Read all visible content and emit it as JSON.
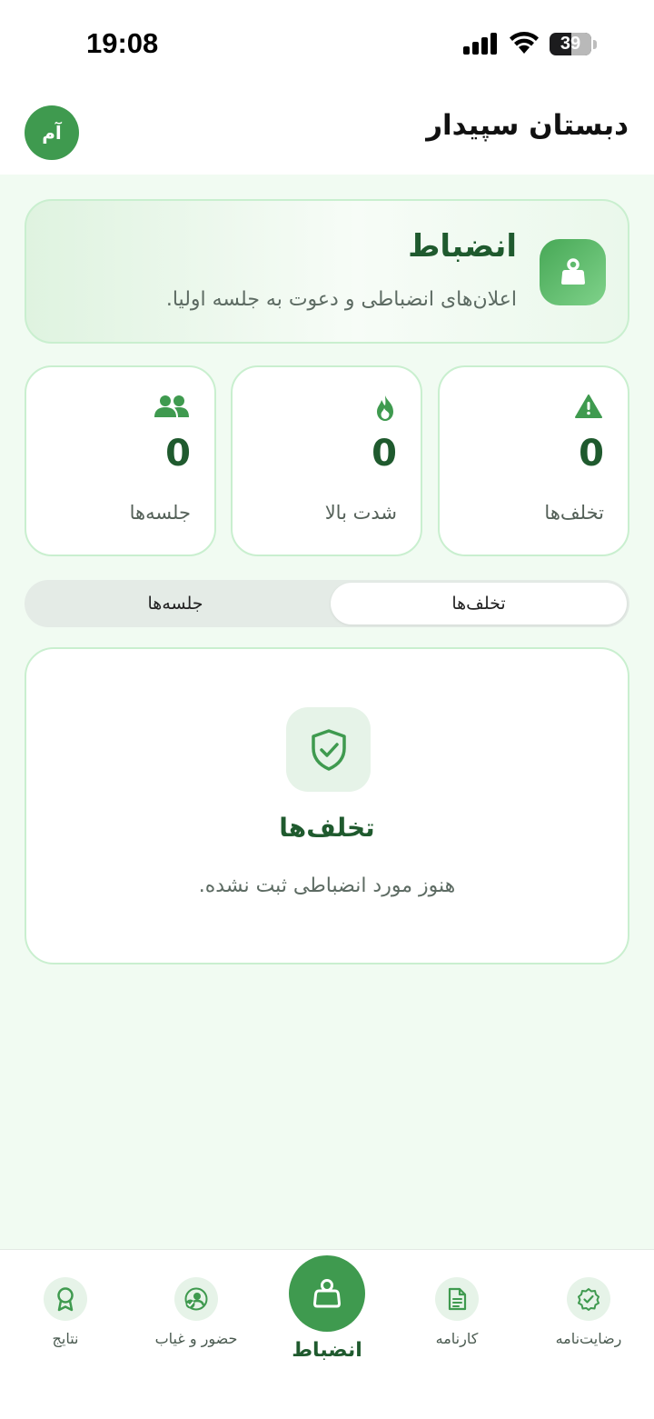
{
  "status_bar": {
    "time": "19:08",
    "battery_level": "39",
    "icons": [
      "cellular-signal-icon",
      "wifi-icon",
      "battery-icon"
    ]
  },
  "header": {
    "school_name": "دبستان سپیدار",
    "avatar_initials": "آم"
  },
  "hero": {
    "title": "انضباط",
    "subtitle": "اعلان‌های انضباطی و دعوت به جلسه اولیا.",
    "icon": "kettlebell-icon"
  },
  "stats": [
    {
      "label": "تخلف‌ها",
      "value": "0",
      "icon": "warning-icon"
    },
    {
      "label": "شدت بالا",
      "value": "0",
      "icon": "flame-icon"
    },
    {
      "label": "جلسه‌ها",
      "value": "0",
      "icon": "users-icon"
    }
  ],
  "tabs": {
    "violations": "تخلف‌ها",
    "meetings": "جلسه‌ها",
    "selected": "violations"
  },
  "empty_state": {
    "title": "تخلف‌ها",
    "message": "هنوز مورد انضباطی ثبت نشده.",
    "icon": "shield-check-icon"
  },
  "bottom_nav": {
    "items": [
      {
        "label": "رضایت‌نامه",
        "icon": "badge-check-icon"
      },
      {
        "label": "کارنامه",
        "icon": "document-icon"
      },
      {
        "label": "انضباط",
        "icon": "kettlebell-icon"
      },
      {
        "label": "حضور و غیاب",
        "icon": "user-check-icon"
      },
      {
        "label": "نتایج",
        "icon": "award-icon"
      }
    ],
    "active": "انضباط"
  },
  "colors": {
    "brand_green": "#3f9a4f",
    "dark_green": "#1f5a2e",
    "background": "#f1fbf2",
    "border": "#c9efcf"
  }
}
